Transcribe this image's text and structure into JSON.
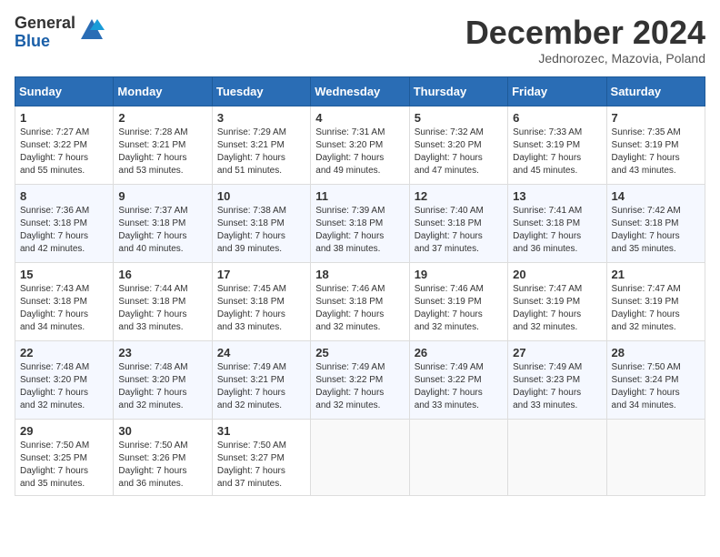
{
  "logo": {
    "general": "General",
    "blue": "Blue"
  },
  "header": {
    "month": "December 2024",
    "location": "Jednorozec, Mazovia, Poland"
  },
  "days_of_week": [
    "Sunday",
    "Monday",
    "Tuesday",
    "Wednesday",
    "Thursday",
    "Friday",
    "Saturday"
  ],
  "weeks": [
    [
      {
        "day": "1",
        "sunrise": "7:27 AM",
        "sunset": "3:22 PM",
        "daylight": "7 hours and 55 minutes."
      },
      {
        "day": "2",
        "sunrise": "7:28 AM",
        "sunset": "3:21 PM",
        "daylight": "7 hours and 53 minutes."
      },
      {
        "day": "3",
        "sunrise": "7:29 AM",
        "sunset": "3:21 PM",
        "daylight": "7 hours and 51 minutes."
      },
      {
        "day": "4",
        "sunrise": "7:31 AM",
        "sunset": "3:20 PM",
        "daylight": "7 hours and 49 minutes."
      },
      {
        "day": "5",
        "sunrise": "7:32 AM",
        "sunset": "3:20 PM",
        "daylight": "7 hours and 47 minutes."
      },
      {
        "day": "6",
        "sunrise": "7:33 AM",
        "sunset": "3:19 PM",
        "daylight": "7 hours and 45 minutes."
      },
      {
        "day": "7",
        "sunrise": "7:35 AM",
        "sunset": "3:19 PM",
        "daylight": "7 hours and 43 minutes."
      }
    ],
    [
      {
        "day": "8",
        "sunrise": "7:36 AM",
        "sunset": "3:18 PM",
        "daylight": "7 hours and 42 minutes."
      },
      {
        "day": "9",
        "sunrise": "7:37 AM",
        "sunset": "3:18 PM",
        "daylight": "7 hours and 40 minutes."
      },
      {
        "day": "10",
        "sunrise": "7:38 AM",
        "sunset": "3:18 PM",
        "daylight": "7 hours and 39 minutes."
      },
      {
        "day": "11",
        "sunrise": "7:39 AM",
        "sunset": "3:18 PM",
        "daylight": "7 hours and 38 minutes."
      },
      {
        "day": "12",
        "sunrise": "7:40 AM",
        "sunset": "3:18 PM",
        "daylight": "7 hours and 37 minutes."
      },
      {
        "day": "13",
        "sunrise": "7:41 AM",
        "sunset": "3:18 PM",
        "daylight": "7 hours and 36 minutes."
      },
      {
        "day": "14",
        "sunrise": "7:42 AM",
        "sunset": "3:18 PM",
        "daylight": "7 hours and 35 minutes."
      }
    ],
    [
      {
        "day": "15",
        "sunrise": "7:43 AM",
        "sunset": "3:18 PM",
        "daylight": "7 hours and 34 minutes."
      },
      {
        "day": "16",
        "sunrise": "7:44 AM",
        "sunset": "3:18 PM",
        "daylight": "7 hours and 33 minutes."
      },
      {
        "day": "17",
        "sunrise": "7:45 AM",
        "sunset": "3:18 PM",
        "daylight": "7 hours and 33 minutes."
      },
      {
        "day": "18",
        "sunrise": "7:46 AM",
        "sunset": "3:18 PM",
        "daylight": "7 hours and 32 minutes."
      },
      {
        "day": "19",
        "sunrise": "7:46 AM",
        "sunset": "3:19 PM",
        "daylight": "7 hours and 32 minutes."
      },
      {
        "day": "20",
        "sunrise": "7:47 AM",
        "sunset": "3:19 PM",
        "daylight": "7 hours and 32 minutes."
      },
      {
        "day": "21",
        "sunrise": "7:47 AM",
        "sunset": "3:19 PM",
        "daylight": "7 hours and 32 minutes."
      }
    ],
    [
      {
        "day": "22",
        "sunrise": "7:48 AM",
        "sunset": "3:20 PM",
        "daylight": "7 hours and 32 minutes."
      },
      {
        "day": "23",
        "sunrise": "7:48 AM",
        "sunset": "3:20 PM",
        "daylight": "7 hours and 32 minutes."
      },
      {
        "day": "24",
        "sunrise": "7:49 AM",
        "sunset": "3:21 PM",
        "daylight": "7 hours and 32 minutes."
      },
      {
        "day": "25",
        "sunrise": "7:49 AM",
        "sunset": "3:22 PM",
        "daylight": "7 hours and 32 minutes."
      },
      {
        "day": "26",
        "sunrise": "7:49 AM",
        "sunset": "3:22 PM",
        "daylight": "7 hours and 33 minutes."
      },
      {
        "day": "27",
        "sunrise": "7:49 AM",
        "sunset": "3:23 PM",
        "daylight": "7 hours and 33 minutes."
      },
      {
        "day": "28",
        "sunrise": "7:50 AM",
        "sunset": "3:24 PM",
        "daylight": "7 hours and 34 minutes."
      }
    ],
    [
      {
        "day": "29",
        "sunrise": "7:50 AM",
        "sunset": "3:25 PM",
        "daylight": "7 hours and 35 minutes."
      },
      {
        "day": "30",
        "sunrise": "7:50 AM",
        "sunset": "3:26 PM",
        "daylight": "7 hours and 36 minutes."
      },
      {
        "day": "31",
        "sunrise": "7:50 AM",
        "sunset": "3:27 PM",
        "daylight": "7 hours and 37 minutes."
      },
      null,
      null,
      null,
      null
    ]
  ]
}
